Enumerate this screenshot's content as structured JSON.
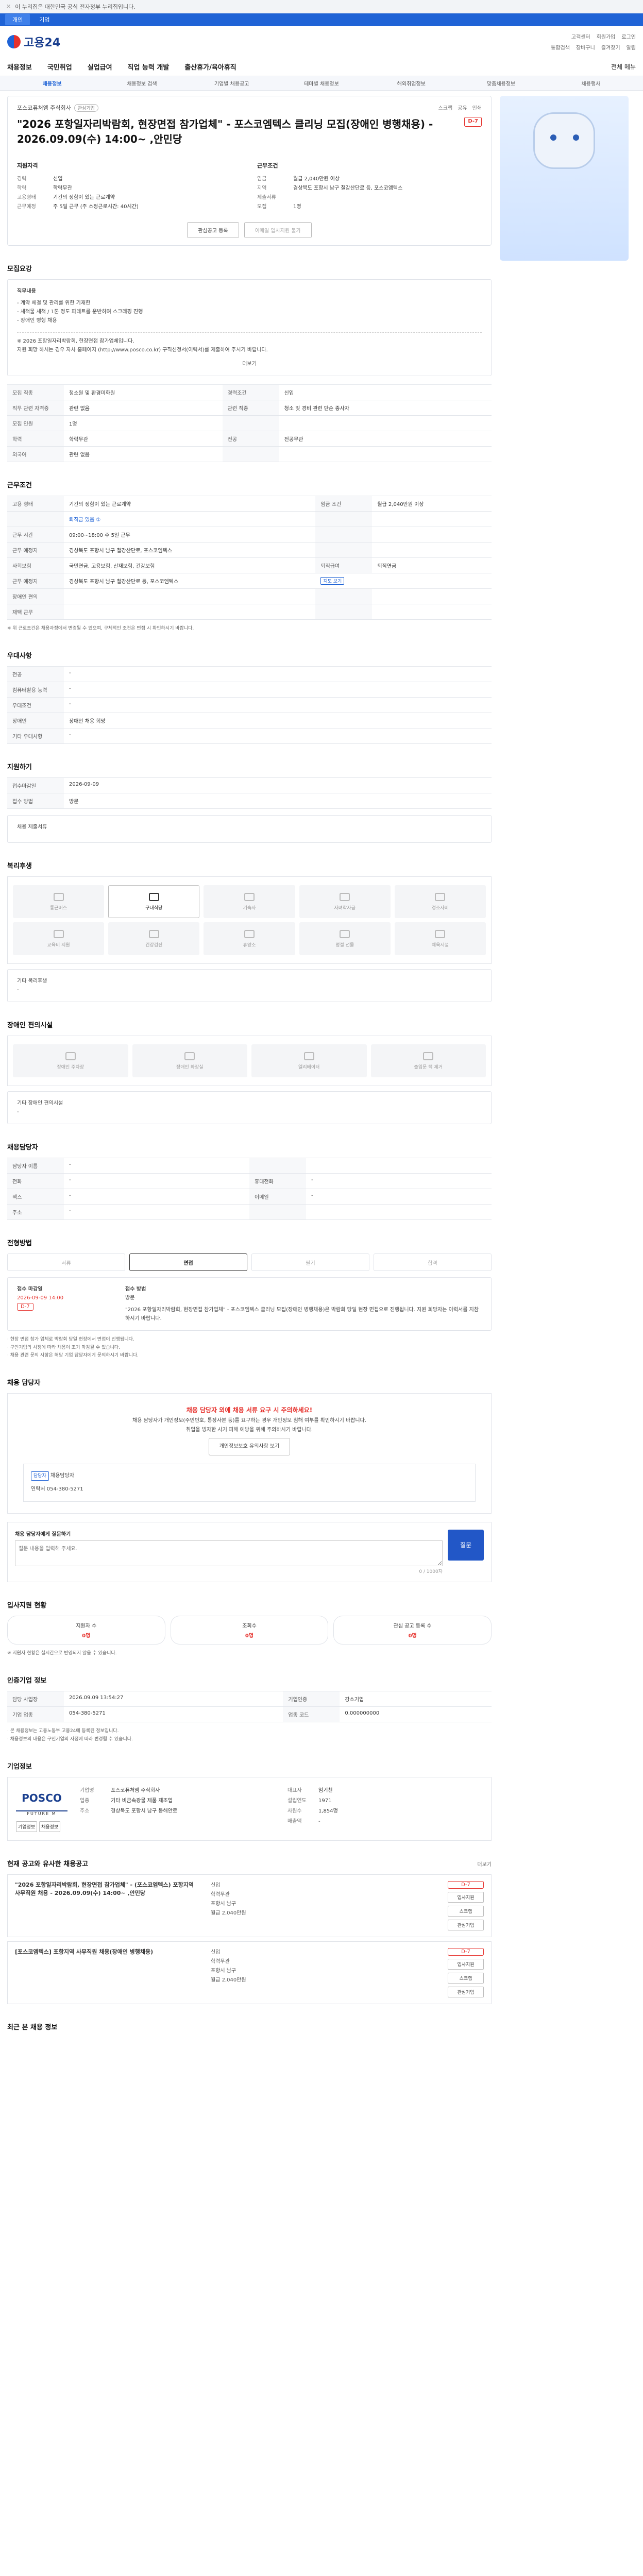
{
  "topbar": {
    "notice": "이 누리집은 대한민국 공식 전자정부 누리집입니다."
  },
  "toptabs": [
    "개인",
    "기업"
  ],
  "header": {
    "logo": "고용24",
    "links": [
      "고객센터",
      "회원가입",
      "로그인"
    ],
    "links2": [
      "통합검색",
      "장바구니",
      "즐겨찾기",
      "알림"
    ]
  },
  "gnb": [
    "채용정보",
    "국민취업",
    "실업급여",
    "직업 능력 개발",
    "출산휴가/육아휴직",
    "전체 메뉴"
  ],
  "subnav": [
    "채용정보",
    "채용정보 검색",
    "기업별 채용공고",
    "테마별 채용정보",
    "해외취업정보",
    "맞춤채용정보",
    "채용행사"
  ],
  "job": {
    "company": "포스코퓨처엠 주식회사",
    "company_tag": "관심기업",
    "title": "\"2026 포항일자리박람회, 현장면접 참가업체\" - 포스코엠텍스 클리닝 모집(장애인 병행채용) - 2026.09.09(수) 14:00~ ,안민당",
    "dday": "D-7",
    "actions": [
      "스크랩",
      "공유",
      "인쇄"
    ],
    "left_head": "지원자격",
    "left": [
      [
        "경력",
        "신입"
      ],
      [
        "학력",
        "학력무관"
      ],
      [
        "",
        ""
      ],
      [
        "고용형태",
        "기간의 정함이 있는 근로계약"
      ],
      [
        "근무예정",
        "주 5일 근무 (주 소정근로시간: 40시간)"
      ]
    ],
    "right_head": "근무조건",
    "right": [
      [
        "임금",
        "월급 2,040만원 이상"
      ],
      [
        "지역",
        "경상북도 포항시 남구 철강산단로 등, 포스코엠텍스"
      ],
      [
        "",
        ""
      ],
      [
        "제출서류",
        ""
      ],
      [
        "모집",
        "1명"
      ]
    ],
    "btn1": "관심공고 등록",
    "btn2": "이메일 입사지원 불가"
  },
  "recruit": {
    "title": "모집요강",
    "body_title": "직무내용",
    "lines": [
      "- 계약 체결 및 관리를 위한 기재한",
      "- 세척물 세척 / 1톤 정도 파레트를 운반하며 스크래핑 진행",
      "- 장애인 병행 채용",
      "※ 2026 포항일자리박람회, 현장면접 참가업체입니다.",
      "지원 희망 하시는 경우 자사 홈페이지 (http://www.posco.co.kr) 구직신청서(이력서)를 제출하여 주시기 바랍니다."
    ],
    "more": "더보기",
    "table": [
      [
        "모집 직종",
        "청소원 및 환경미화원",
        "경력조건",
        "신입"
      ],
      [
        "직무 관련 자격증",
        "관련 없음",
        "관련 직종",
        "청소 및 경비 관련 단순 종사자"
      ],
      [
        "모집 인원",
        "1명",
        "",
        ""
      ],
      [
        "학력",
        "학력무관",
        "전공",
        "전공무관"
      ],
      [
        "외국어",
        "관련 없음",
        "",
        ""
      ]
    ]
  },
  "work": {
    "title": "근무조건",
    "table": [
      [
        "고용 형태",
        "기간의 정함이 있는 근로계약",
        "임금 조건",
        "월급 2,040만원 이상"
      ],
      [
        "",
        "퇴직금 있음 ①",
        "",
        ""
      ],
      [
        "근무 시간",
        "09:00~18:00 주 5일 근무",
        "",
        ""
      ],
      [
        "근무 예정지",
        "경상북도 포항시 남구 철강산단로, 포스코엠텍스",
        "",
        ""
      ],
      [
        "사회보험",
        "국민연금, 고용보험, 산재보험, 건강보험",
        "퇴직급여",
        "퇴직연금"
      ],
      [
        "근무 예정지",
        "경상북도 포항시 남구 철강산단로 등, 포스코엠텍스",
        "지도 보기",
        ""
      ],
      [
        "장애인 편의",
        "",
        "",
        ""
      ],
      [
        "재택 근무",
        "",
        "",
        ""
      ]
    ],
    "note": "※ 위 근로조건은 채용과정에서 변경될 수 있으며, 구체적인 조건은 면접 시 확인하시기 바랍니다."
  },
  "intent": {
    "title": "우대사항",
    "rows": [
      [
        "전공",
        "-"
      ],
      [
        "컴퓨터활용 능력",
        "-"
      ],
      [
        "우대조건",
        "-"
      ],
      [
        "장애인",
        "장애인 채용 희망"
      ],
      [
        "기타 우대사항",
        "-"
      ]
    ]
  },
  "apply": {
    "title": "지원하기",
    "rows": [
      [
        "접수마감일",
        "2026-09-09"
      ],
      [
        "접수 방법",
        "방문"
      ]
    ],
    "more": "채용 제출서류"
  },
  "welfare": {
    "title": "복리후생",
    "icons": [
      "통근버스",
      "구내식당",
      "기숙사",
      "자녀학자금",
      "경조사비",
      "교육비 지원",
      "건강검진",
      "휴양소",
      "명절 선물",
      "체육시설"
    ],
    "note": "기타 복리후생",
    "note_val": "-"
  },
  "disabled": {
    "title": "장애인 편의시설",
    "icons": [
      "장애인 주차장",
      "장애인 화장실",
      "엘리베이터",
      "출입문 턱 제거"
    ],
    "note": "기타 장애인 편의시설",
    "note_val": "-"
  },
  "manager": {
    "title": "채용담당자",
    "rows": [
      [
        "담당자 이름",
        "-",
        "",
        ""
      ],
      [
        "전화",
        "-",
        "휴대전화",
        "-"
      ],
      [
        "팩스",
        "-",
        "이메일",
        "-"
      ],
      [
        "주소",
        "-",
        "",
        ""
      ]
    ]
  },
  "process": {
    "title": "전형방법",
    "steps": [
      "서류",
      "면접",
      "필기",
      "합격"
    ],
    "date_label": "접수 마감일",
    "date": "2026-09-09 14:00",
    "d": "D-7",
    "method_label": "접수 방법",
    "method": "방문",
    "desc": "\"2026 포항일자리박람회, 현장면접 참가업체\" - 포스코엠텍스 클리닝 모집(장애인 병행채용)은 박람회 당일 현장 면접으로 진행됩니다. 지원 희망자는 이력서를 지참하시기 바랍니다.",
    "notes": [
      "· 현장 면접 참가 업체로 박람회 당일 현장에서 면접이 진행됩니다.",
      "· 구인기업의 사정에 따라 채용이 조기 마감될 수 있습니다.",
      "· 채용 관련 문의 사항은 해당 기업 담당자에게 문의하시기 바랍니다."
    ]
  },
  "applyzone": {
    "title": "채용 담당자",
    "warn": "채용 담당자 외에 채용 서류 요구 시 주의하세요!",
    "lines": [
      "채용 담당자가 개인정보(주민번호, 통장사본 등)를 요구하는 경우 개인정보 침해 여부를 확인하시기 바랍니다.",
      "취업을 빙자한 사기 피해 예방을 위해 주의하시기 바랍니다."
    ],
    "btn": "개인정보보호 유의사항 보기",
    "inner_label": "담당자",
    "inner_name": "채용담당자",
    "inner_phone_label": "연락처",
    "inner_phone": "054-380-5271",
    "inner2_label": "채용 담당자에게 질문하기",
    "inner2_ph": "질문 내용을 입력해 주세요.",
    "counter": "0 / 1000자",
    "apply": "질문"
  },
  "stats": {
    "title": "입사지원 현황",
    "items": [
      [
        "지원자 수",
        "0명"
      ],
      [
        "조회수",
        "0명"
      ],
      [
        "관심 공고 등록 수",
        "0명"
      ]
    ],
    "note": "※ 지원자 현황은 실시간으로 반영되지 않을 수 있습니다."
  },
  "info": {
    "title": "인증기업 정보",
    "rows": [
      [
        "담당 사업장",
        "2026.09.09 13:54:27",
        "기업인증",
        "강소기업"
      ],
      [
        "기업 업종",
        "054-380-5271",
        "업종 코드",
        "0.000000000"
      ]
    ],
    "notes": [
      "· 본 채용정보는 고용노동부 고용24에 등록된 정보입니다.",
      "· 채용정보의 내용은 구인기업의 사정에 따라 변경될 수 있습니다."
    ]
  },
  "corp": {
    "title": "기업정보",
    "logo": "POSCO",
    "sub": "FUTURE M",
    "name": "포스코퓨처엠 주식회사",
    "rows": [
      [
        "기업명",
        "포스코퓨처엠 주식회사"
      ],
      [
        "업종",
        "기타 비금속광물 제품 제조업"
      ],
      [
        "주소",
        "경상북도 포항시 남구 동해안로"
      ]
    ],
    "rows2": [
      [
        "대표자",
        "엄기천"
      ],
      [
        "설립연도",
        "1971"
      ],
      [
        "사원수",
        "1,854명"
      ],
      [
        "매출액",
        "-"
      ]
    ],
    "btns": [
      "기업정보",
      "채용정보"
    ]
  },
  "recent": {
    "title": "현재 공고와 유사한 채용공고",
    "more": "더보기",
    "items": [
      {
        "title": "\"2026 포항일자리박람회, 현장면접 참가업체\" - (포스코엠텍스) 포항지역 사무직원 채용 - 2026.09.09(수) 14:00~ ,안민당",
        "meta": [
          "신입",
          "학력무관",
          "포항시 남구",
          "월급 2,040만원"
        ],
        "tag": "D-7"
      },
      {
        "title": "[포스코엠텍스] 포항지역 사무직원 채용(장애인 병행채용)",
        "meta": [
          "신입",
          "학력무관",
          "포항시 남구",
          "월급 2,040만원"
        ],
        "tag": "D-7"
      }
    ],
    "side": [
      "입사지원",
      "스크랩",
      "관심기업"
    ]
  },
  "bottom": {
    "title": "최근 본 채용 정보"
  }
}
